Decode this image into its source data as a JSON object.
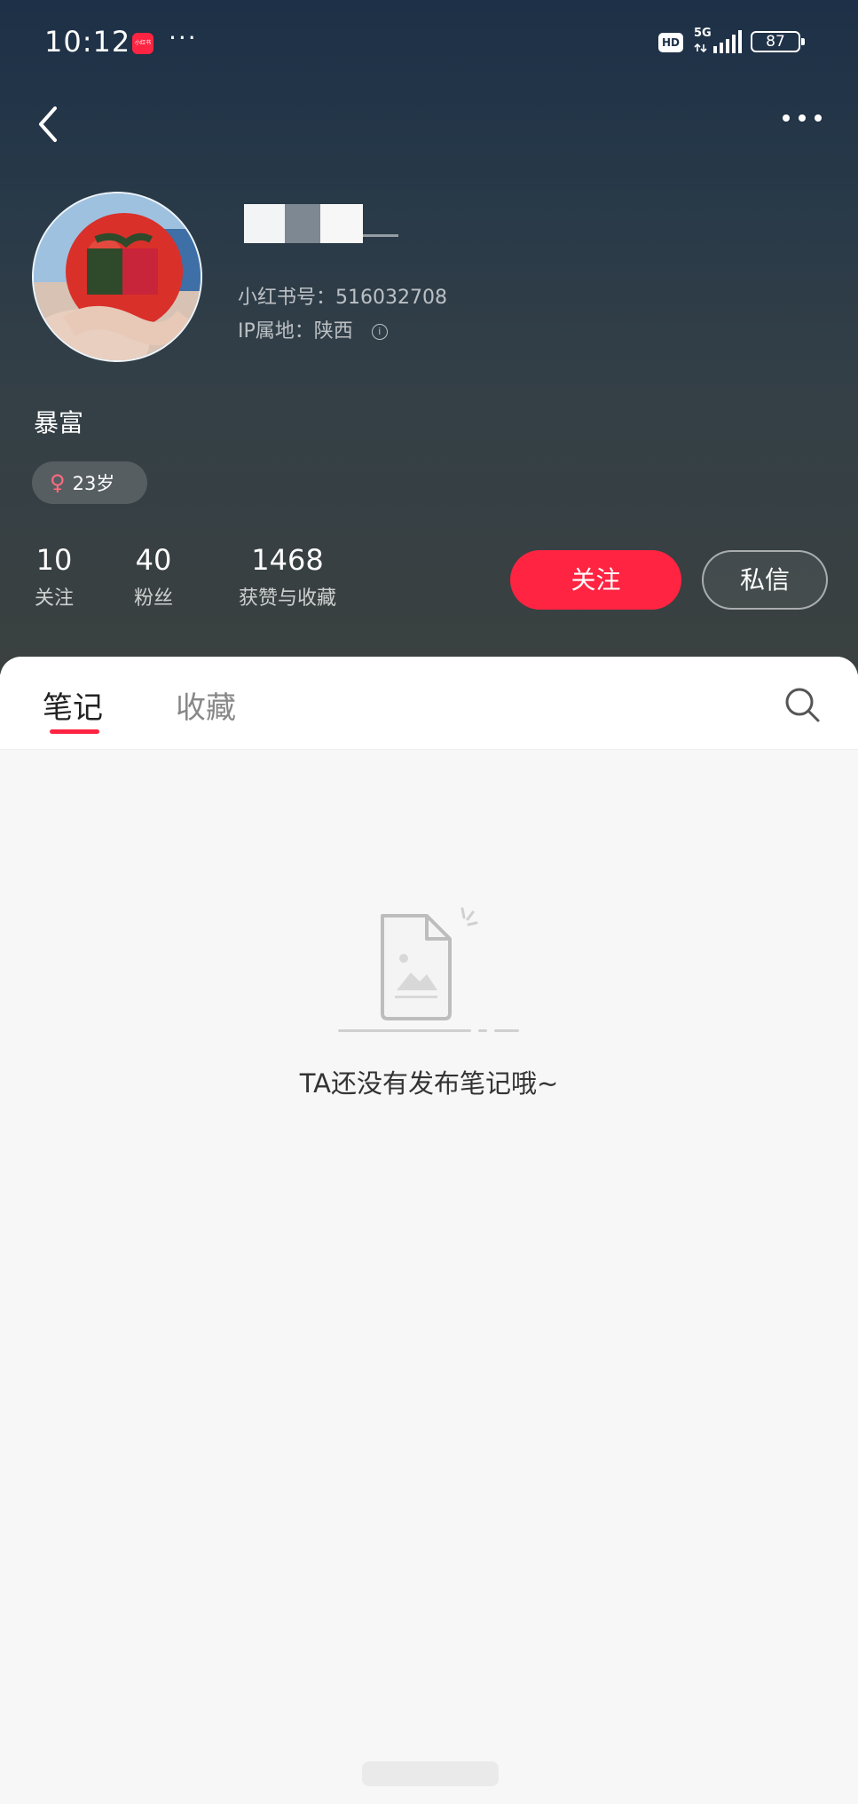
{
  "status_bar": {
    "time": "10:12",
    "app_badge": "小红书",
    "more": "···",
    "hd": "HD",
    "network": "5G",
    "battery": "87"
  },
  "profile": {
    "id_line": "小红书号：516032708",
    "ip_line": "IP属地：陕西",
    "info_icon": "i",
    "bio": "暴富",
    "gender_symbol": "♀",
    "age": "23岁"
  },
  "stats": [
    {
      "value": "10",
      "label": "关注"
    },
    {
      "value": "40",
      "label": "粉丝"
    },
    {
      "value": "1468",
      "label": "获赞与收藏"
    }
  ],
  "actions": {
    "follow": "关注",
    "message": "私信"
  },
  "tabs": [
    {
      "label": "笔记",
      "active": true
    },
    {
      "label": "收藏",
      "active": false
    }
  ],
  "empty_state": {
    "text": "TA还没有发布笔记哦~"
  },
  "icons": {
    "back": "chevron-left-icon",
    "more": "more-dots-icon",
    "search": "search-icon",
    "info": "info-icon",
    "gender": "female-icon",
    "empty": "empty-note-illustration"
  },
  "colors": {
    "accent": "#ff2442",
    "header_top": "#1d3047",
    "header_bottom": "#3b4140",
    "panel_bg": "#f7f7f7"
  }
}
